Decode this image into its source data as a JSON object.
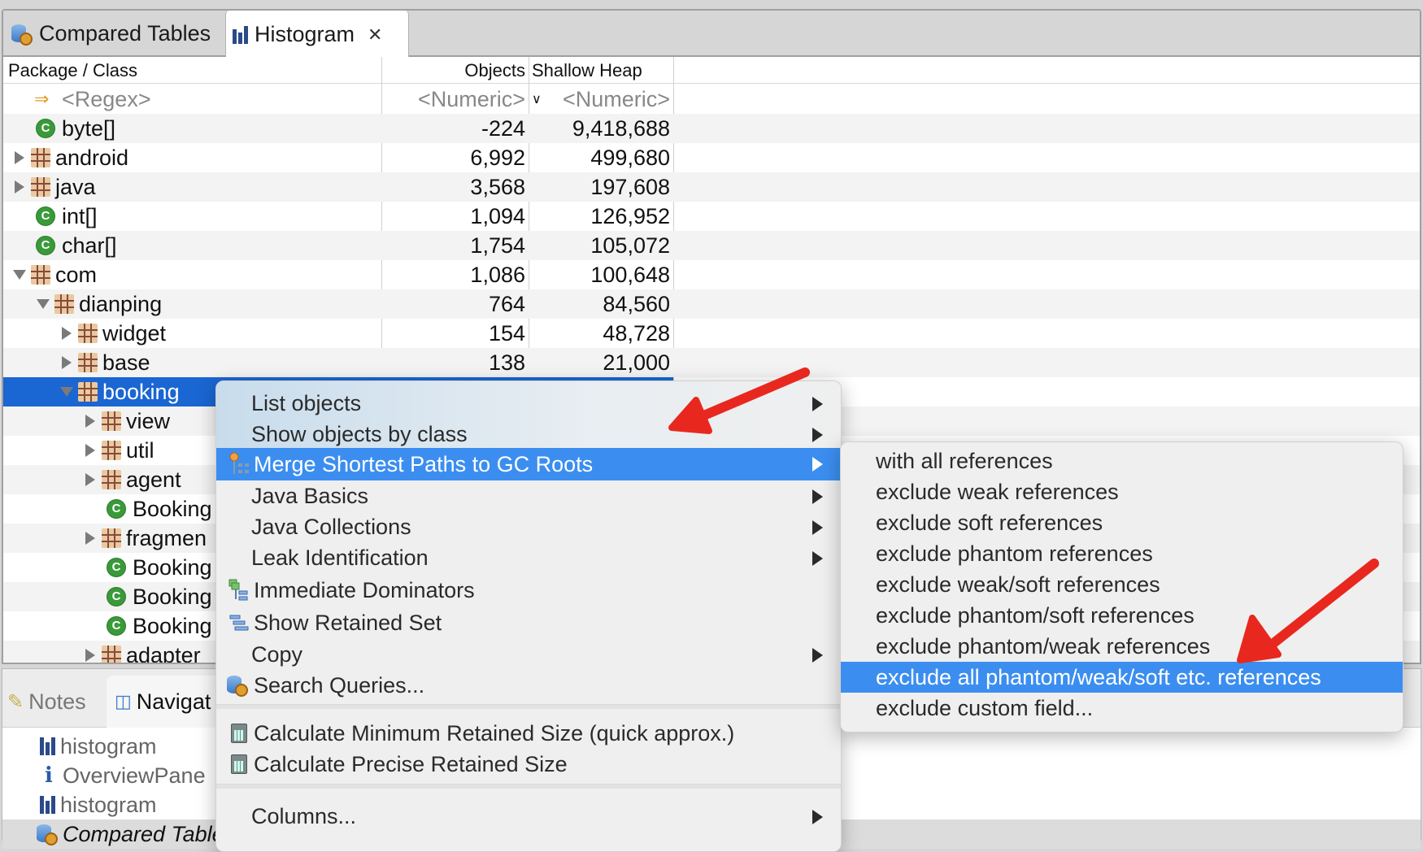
{
  "editor": {
    "tabs": [
      {
        "label": "Compared Tables",
        "icon": "database-gear-icon",
        "active": false
      },
      {
        "label": "Histogram",
        "icon": "histogram-icon",
        "active": true,
        "close": "✕"
      }
    ]
  },
  "table": {
    "columns": [
      "Package / Class",
      "Objects",
      "Shallow Heap"
    ],
    "sort_indicator": "⌄",
    "filter_row": {
      "name": "<Regex>",
      "objects": "<Numeric>",
      "shallow": "<Numeric>"
    },
    "rows": [
      {
        "name": "byte[]",
        "type": "class",
        "twisty": "none",
        "depth": 0,
        "objects": "-224",
        "shallow": "9,418,688"
      },
      {
        "name": "android",
        "type": "package",
        "twisty": "collapsed",
        "depth": 0,
        "objects": "6,992",
        "shallow": "499,680"
      },
      {
        "name": "java",
        "type": "package",
        "twisty": "collapsed",
        "depth": 0,
        "objects": "3,568",
        "shallow": "197,608"
      },
      {
        "name": "int[]",
        "type": "class",
        "twisty": "none",
        "depth": 0,
        "objects": "1,094",
        "shallow": "126,952"
      },
      {
        "name": "char[]",
        "type": "class",
        "twisty": "none",
        "depth": 0,
        "objects": "1,754",
        "shallow": "105,072"
      },
      {
        "name": "com",
        "type": "package",
        "twisty": "expanded",
        "depth": 0,
        "objects": "1,086",
        "shallow": "100,648"
      },
      {
        "name": "dianping",
        "type": "package",
        "twisty": "expanded",
        "depth": 1,
        "objects": "764",
        "shallow": "84,560"
      },
      {
        "name": "widget",
        "type": "package",
        "twisty": "collapsed",
        "depth": 2,
        "objects": "154",
        "shallow": "48,728"
      },
      {
        "name": "base",
        "type": "package",
        "twisty": "collapsed",
        "depth": 2,
        "objects": "138",
        "shallow": "21,000"
      },
      {
        "name": "booking",
        "type": "package",
        "twisty": "expanded",
        "depth": 2,
        "objects": "",
        "shallow": "",
        "selected": true
      },
      {
        "name": "view",
        "type": "package",
        "twisty": "collapsed",
        "depth": 3,
        "objects": "",
        "shallow": ""
      },
      {
        "name": "util",
        "type": "package",
        "twisty": "collapsed",
        "depth": 3,
        "objects": "",
        "shallow": ""
      },
      {
        "name": "agent",
        "type": "package",
        "twisty": "collapsed",
        "depth": 3,
        "objects": "",
        "shallow": ""
      },
      {
        "name": "Booking",
        "type": "class",
        "twisty": "none",
        "depth": 3,
        "objects": "",
        "shallow": ""
      },
      {
        "name": "fragmen",
        "type": "package",
        "twisty": "collapsed",
        "depth": 3,
        "objects": "",
        "shallow": ""
      },
      {
        "name": "Booking",
        "type": "class",
        "twisty": "none",
        "depth": 3,
        "objects": "",
        "shallow": ""
      },
      {
        "name": "Booking",
        "type": "class",
        "twisty": "none",
        "depth": 3,
        "objects": "",
        "shallow": ""
      },
      {
        "name": "Booking",
        "type": "class",
        "twisty": "none",
        "depth": 3,
        "objects": "",
        "shallow": ""
      },
      {
        "name": "adapter",
        "type": "package",
        "twisty": "collapsed",
        "depth": 3,
        "objects": "",
        "shallow": ""
      }
    ]
  },
  "bottom_panel": {
    "tabs": [
      {
        "label": "Notes",
        "icon": "notes-icon"
      },
      {
        "label": "Navigat",
        "icon": "navigator-icon"
      }
    ],
    "items": [
      {
        "label": "histogram",
        "icon": "histogram-icon"
      },
      {
        "label": "OverviewPane",
        "icon": "info-icon"
      },
      {
        "label": "histogram",
        "icon": "histogram-icon"
      },
      {
        "label": "Compared Table",
        "icon": "database-gear-icon",
        "selected": true
      }
    ]
  },
  "context_menu": {
    "items": [
      {
        "label": "List objects",
        "submenu": true
      },
      {
        "label": "Show objects by class",
        "submenu": true
      },
      {
        "label": "Merge Shortest Paths to GC Roots",
        "submenu": true,
        "icon": "gc-paths-icon",
        "highlighted": true
      },
      {
        "label": "Java Basics",
        "submenu": true
      },
      {
        "label": "Java Collections",
        "submenu": true
      },
      {
        "label": "Leak Identification",
        "submenu": true
      },
      {
        "label": "Immediate Dominators",
        "icon": "dominators-icon"
      },
      {
        "label": "Show Retained Set",
        "icon": "retained-set-icon"
      },
      {
        "label": "Copy",
        "submenu": true
      },
      {
        "label": "Search Queries...",
        "icon": "database-gear-icon"
      },
      {
        "label": "Calculate Minimum Retained Size (quick approx.)",
        "icon": "calculator-icon"
      },
      {
        "label": "Calculate Precise Retained Size",
        "icon": "calculator-icon"
      },
      {
        "label": "Columns...",
        "submenu": true
      }
    ]
  },
  "submenu": {
    "items": [
      {
        "label": "with all references"
      },
      {
        "label": "exclude weak references"
      },
      {
        "label": "exclude soft references"
      },
      {
        "label": "exclude phantom references"
      },
      {
        "label": "exclude weak/soft references"
      },
      {
        "label": "exclude phantom/soft references"
      },
      {
        "label": "exclude phantom/weak references"
      },
      {
        "label": "exclude all phantom/weak/soft etc. references",
        "highlighted": true
      },
      {
        "label": "exclude custom field..."
      }
    ]
  },
  "colors": {
    "selection": "#1a66d2",
    "menu_highlight": "#3b8ef0",
    "annotation_arrow": "#e8281e"
  }
}
